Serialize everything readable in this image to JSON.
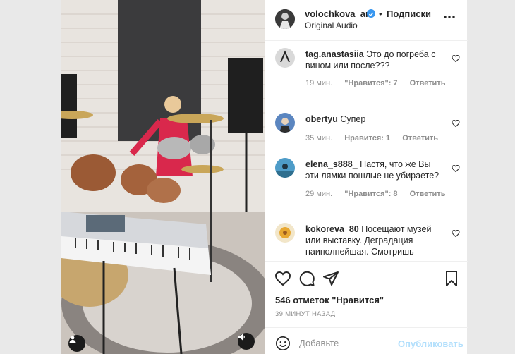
{
  "header": {
    "username": "volochkova_art",
    "separator": "•",
    "follow_label": "Подписки",
    "audio": "Original Audio",
    "more_icon": "more-icon"
  },
  "comments": [
    {
      "username": "tag.anastasiia",
      "text": "Это до погреба с вином или после???",
      "time": "19 мин.",
      "likes": "\"Нравится\": 7",
      "reply": "Ответить",
      "avatar_color": "#8a8a8a"
    },
    {
      "username": "obertyu",
      "text": "Супер",
      "time": "35 мин.",
      "likes": "Нравится: 1",
      "reply": "Ответить",
      "avatar_color": "#4d7fb8"
    },
    {
      "username": "elena_s888_",
      "text": "Настя, что же Вы эти лямки пошлые не убираете?",
      "time": "29 мин.",
      "likes": "\"Нравится\": 8",
      "reply": "Ответить",
      "avatar_color": "#4a90b8"
    },
    {
      "username": "kokoreva_80",
      "text": "Посещают музей или выставку. Деградация наиполнейшая. Смотришь",
      "avatar_color": "#e8a832"
    }
  ],
  "post": {
    "likes": "546 отметок \"Нравится\"",
    "time": "39 МИНУТ НАЗАД"
  },
  "add_comment": {
    "placeholder": "Добавьте",
    "publish_label": "Опубликовать"
  },
  "colors": {
    "verified": "#3897f0",
    "publish_disabled": "#b2dffc",
    "muted": "#8e8e8e"
  }
}
